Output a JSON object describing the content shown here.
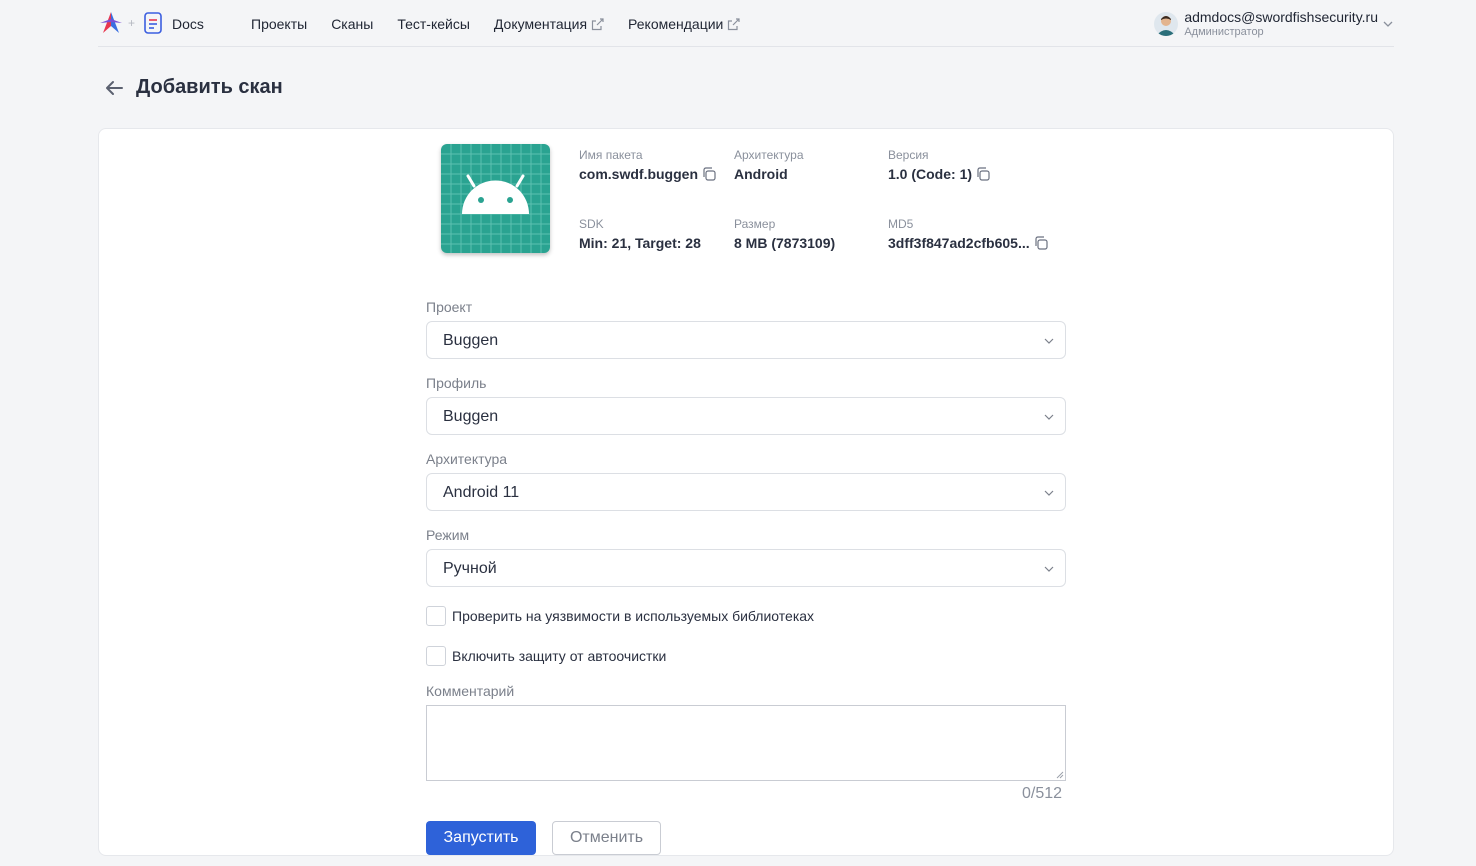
{
  "header": {
    "logo_icon": "swordfish-logo-icon",
    "plus": "+",
    "docs_icon": "document-icon",
    "docs_label": "Docs",
    "nav": [
      {
        "label": "Проекты",
        "external": false
      },
      {
        "label": "Сканы",
        "external": false
      },
      {
        "label": "Тест-кейсы",
        "external": false
      },
      {
        "label": "Документация",
        "external": true
      },
      {
        "label": "Рекомендации",
        "external": true
      }
    ],
    "user": {
      "email": "admdocs@swordfishsecurity.ru",
      "role": "Администратор"
    }
  },
  "page": {
    "title": "Добавить скан"
  },
  "app_info": {
    "icon": "android-icon",
    "package_label": "Имя пакета",
    "package_value": "com.swdf.buggen",
    "arch_label": "Архитектура",
    "arch_value": "Android",
    "version_label": "Версия",
    "version_value": "1.0 (Code: 1)",
    "sdk_label": "SDK",
    "sdk_value": "Min: 21, Target: 28",
    "size_label": "Размер",
    "size_value": "8 MB (7873109)",
    "md5_label": "MD5",
    "md5_value": "3dff3f847ad2cfb605..."
  },
  "form": {
    "project_label": "Проект",
    "project_value": "Buggen",
    "profile_label": "Профиль",
    "profile_value": "Buggen",
    "arch_label": "Архитектура",
    "arch_value": "Android 11",
    "mode_label": "Режим",
    "mode_value": "Ручной",
    "check_libs_label": "Проверить на уязвимости в используемых библиотеках",
    "check_libs_checked": false,
    "autoclean_label": "Включить защиту от автоочистки",
    "autoclean_checked": false,
    "comment_label": "Комментарий",
    "comment_value": "",
    "comment_counter": "0/512",
    "submit_label": "Запустить",
    "cancel_label": "Отменить"
  },
  "colors": {
    "primary": "#2e62d9",
    "android_bg": "#2aa391",
    "page_bg": "#f4f5f7"
  }
}
